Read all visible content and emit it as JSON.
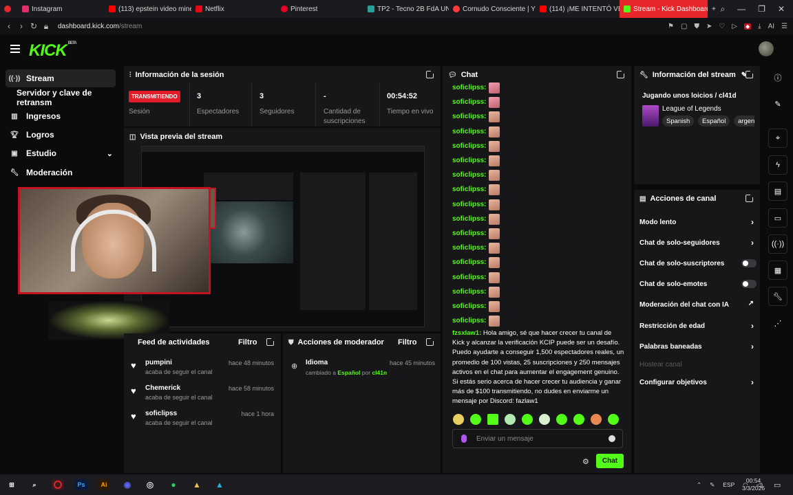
{
  "browser": {
    "tabs": [
      {
        "label": "Instagram",
        "color": "#e1306c"
      },
      {
        "label": "(113) epstein video mine",
        "color": "#ff0000"
      },
      {
        "label": "Netflix",
        "color": "#e50914"
      },
      {
        "label": "Pinterest",
        "color": "#e60023"
      },
      {
        "label": "TP2 - Tecno 2B FdA UN",
        "color": "#2aa198"
      },
      {
        "label": "Cornudo Consciente | Y",
        "color": "#ff3b3b"
      },
      {
        "label": "(114) ¡ME INTENTÓ VEN",
        "color": "#ff0000"
      },
      {
        "label": "Stream - Kick Dashboard",
        "color": "#53fc18"
      }
    ],
    "url_host": "dashboard.kick.com",
    "url_path": "/stream",
    "ext_ai": "AI"
  },
  "app": {
    "logo": "KICK",
    "logo_sup": "BETA"
  },
  "sidebar": {
    "items": [
      {
        "label": "Stream",
        "icon": "stream-icon"
      },
      {
        "label": "Servidor y clave de retransm",
        "icon": ""
      },
      {
        "label": "Ingresos",
        "icon": "chart-icon"
      },
      {
        "label": "Logros",
        "icon": "trophy-icon"
      },
      {
        "label": "Estudio",
        "icon": "studio-icon"
      },
      {
        "label": "Moderación",
        "icon": "wrench-icon"
      }
    ]
  },
  "session": {
    "title": "Información de la sesión",
    "live_badge": "TRANSMITIENDO",
    "stats": [
      {
        "value": "",
        "label": "Sesión"
      },
      {
        "value": "3",
        "label": "Espectadores"
      },
      {
        "value": "3",
        "label": "Seguidores"
      },
      {
        "value": "-",
        "label": "Cantidad de suscripciones"
      },
      {
        "value": "00:54:52",
        "label": "Tiempo en vivo"
      }
    ]
  },
  "preview": {
    "title": "Vista previa del stream"
  },
  "activity": {
    "title": "Feed de actividades",
    "filter": "Filtro",
    "rows": [
      {
        "name": "pumpini",
        "desc": "acaba de seguir el canal",
        "time": "hace 48 minutos"
      },
      {
        "name": "Chemerick",
        "desc": "acaba de seguir el canal",
        "time": "hace 58 minutos"
      },
      {
        "name": "soficlipss",
        "desc": "acaba de seguir el canal",
        "time": "hace 1 hora"
      }
    ]
  },
  "modactions": {
    "title": "Acciones de moderador",
    "filter": "Filtro",
    "row": {
      "title": "Idioma",
      "time": "hace 45 minutos",
      "pre": "cambiado a",
      "lang": "Español",
      "by": "por",
      "user": "cl41n"
    }
  },
  "chat": {
    "title": "Chat",
    "repeat_user": "soficlipss:",
    "big_user": "fzsxlaw1:",
    "big_text": "Hola amigo, sé que hacer crecer tu canal de Kick y alcanzar la verificación KCIP puede ser un desafío. Puedo ayudarte a conseguir 1,500 espectadores reales, un promedio de 100 vistas, 25 suscripciones y 250 mensajes activos en el chat para aumentar el engagement genuino. Si estás serio acerca de hacer crecer tu audiencia y ganar más de $100 transmitiendo, no dudes en enviarme un mensaje por Discord: fazlaw1",
    "placeholder": "Enviar un mensaje",
    "send": "Chat"
  },
  "streaminfo": {
    "title": "Información del stream",
    "stream_title": "Jugando unos loicios / cl41d",
    "category": "League of Legends",
    "tags": [
      "Spanish",
      "Español",
      "argen"
    ]
  },
  "channel": {
    "title": "Acciones de canal",
    "actions": [
      {
        "label": "Modo lento",
        "kind": "chevron"
      },
      {
        "label": "Chat de solo-seguidores",
        "kind": "chevron"
      },
      {
        "label": "Chat de solo-suscriptores",
        "kind": "toggle"
      },
      {
        "label": "Chat de solo-emotes",
        "kind": "toggle"
      },
      {
        "label": "Moderación del chat con IA",
        "kind": "external"
      },
      {
        "label": "Restricción de edad",
        "kind": "chevron"
      },
      {
        "label": "Palabras baneadas",
        "kind": "chevron"
      },
      {
        "label": "Hostear canal",
        "kind": "disabled"
      },
      {
        "label": "Configurar objetivos",
        "kind": "chevron"
      }
    ]
  },
  "taskbar": {
    "lang": "ESP",
    "time": "00:54",
    "date": "3/3/2026",
    "apps": [
      "Ps",
      "Ai"
    ]
  }
}
